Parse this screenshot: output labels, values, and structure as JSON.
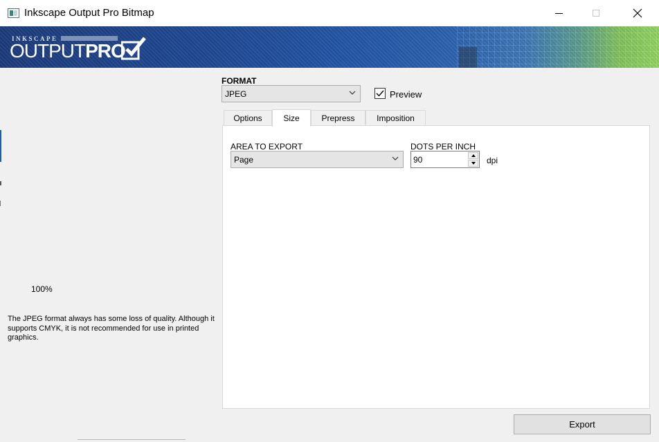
{
  "window": {
    "title": "Inkscape Output Pro Bitmap"
  },
  "banner": {
    "logo_small": "INKSCAPE",
    "logo_main_light": "OUTPUT",
    "logo_main_bold": "PRO"
  },
  "left_pane": {
    "zoom": "100%",
    "description": "The JPEG format always has some loss of quality. Although it supports CMYK, it is not recommended for use in printed graphics."
  },
  "format": {
    "label": "FORMAT",
    "selected": "JPEG",
    "preview_label": "Preview",
    "preview_checked": true
  },
  "tabs": [
    {
      "label": "Options",
      "active": false
    },
    {
      "label": "Size",
      "active": true
    },
    {
      "label": "Prepress",
      "active": false
    },
    {
      "label": "Imposition",
      "active": false
    }
  ],
  "size_tab": {
    "area_label": "AREA TO EXPORT",
    "area_selected": "Page",
    "dpi_label": "DOTS PER INCH",
    "dpi_value": "90",
    "dpi_unit": "dpi"
  },
  "actions": {
    "export_label": "Export"
  },
  "colors": {
    "banner_blue": "#1f4a96",
    "banner_green": "#8fd060"
  }
}
